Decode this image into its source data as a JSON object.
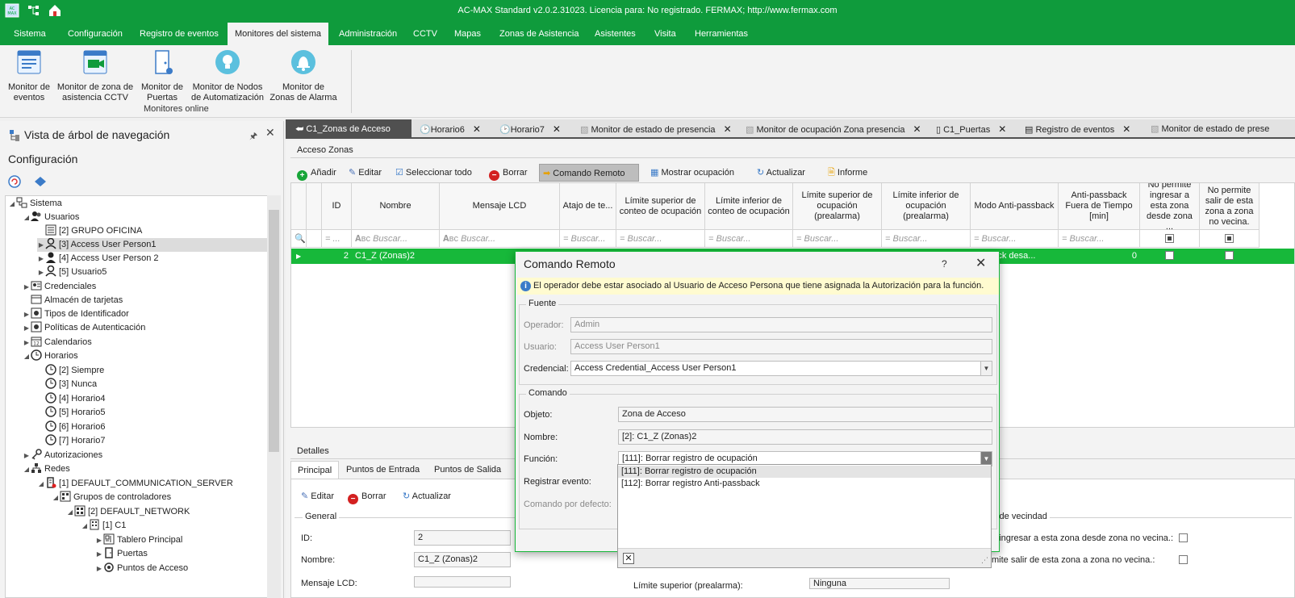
{
  "app": {
    "title": "AC-MAX Standard v2.0.2.31023. Licencia para: No registrado. FERMAX; http://www.fermax.com",
    "accent": "#0f9b3c"
  },
  "ribbon_tabs": [
    {
      "label": "Sistema"
    },
    {
      "label": "Configuración"
    },
    {
      "label": "Registro de eventos"
    },
    {
      "label": "Monitores del sistema"
    },
    {
      "label": "Administración"
    },
    {
      "label": "CCTV"
    },
    {
      "label": "Mapas"
    },
    {
      "label": "Zonas de Asistencia"
    },
    {
      "label": "Asistentes"
    },
    {
      "label": "Visita"
    },
    {
      "label": "Herramientas"
    }
  ],
  "ribbon": {
    "buttons": [
      {
        "label1": "Monitor de",
        "label2": "eventos"
      },
      {
        "label1": "Monitor de zona de",
        "label2": "asistencia CCTV"
      },
      {
        "label1": "Monitor de",
        "label2": "Puertas"
      },
      {
        "label1": "Monitor de Nodos",
        "label2": "de Automatización"
      },
      {
        "label1": "Monitor de",
        "label2": "Zonas de Alarma"
      }
    ],
    "group_label": "Monitores online"
  },
  "nav": {
    "title": "Vista de árbol de navegación",
    "subtitle": "Configuración",
    "tree": [
      {
        "label": "Sistema"
      },
      {
        "label": "Usuarios"
      },
      {
        "label": "[2] GRUPO OFICINA"
      },
      {
        "label": "[3] Access User Person1"
      },
      {
        "label": "[4] Access User Person 2"
      },
      {
        "label": "[5] Usuario5"
      },
      {
        "label": "Credenciales"
      },
      {
        "label": "Almacén de tarjetas"
      },
      {
        "label": "Tipos de Identificador"
      },
      {
        "label": "Políticas de Autenticación"
      },
      {
        "label": "Calendarios"
      },
      {
        "label": "Horarios"
      },
      {
        "label": "[2] Siempre"
      },
      {
        "label": "[3] Nunca"
      },
      {
        "label": "[4] Horario4"
      },
      {
        "label": "[5] Horario5"
      },
      {
        "label": "[6] Horario6"
      },
      {
        "label": "[7] Horario7"
      },
      {
        "label": "Autorizaciones"
      },
      {
        "label": "Redes"
      },
      {
        "label": "[1] DEFAULT_COMMUNICATION_SERVER"
      },
      {
        "label": "Grupos de controladores"
      },
      {
        "label": "[2] DEFAULT_NETWORK"
      },
      {
        "label": "[1] C1"
      },
      {
        "label": "Tablero Principal"
      },
      {
        "label": "Puertas"
      },
      {
        "label": "Puntos de Acceso"
      }
    ]
  },
  "doc_tabs": [
    {
      "label": "C1_Zonas de Acceso"
    },
    {
      "label": "Horario6"
    },
    {
      "label": "Horario7"
    },
    {
      "label": "Monitor de estado de presencia"
    },
    {
      "label": "Monitor de ocupación Zona presencia"
    },
    {
      "label": "C1_Puertas"
    },
    {
      "label": "Registro de eventos"
    },
    {
      "label": "Monitor de estado de prese"
    }
  ],
  "main": {
    "section": "Acceso Zonas",
    "toolbar": {
      "add": "Añadir",
      "edit": "Editar",
      "select_all": "Seleccionar todo",
      "delete": "Borrar",
      "remote": "Comando Remoto",
      "show_occ": "Mostrar ocupación",
      "refresh": "Actualizar",
      "report": "Informe"
    },
    "columns": [
      {
        "label": "ID"
      },
      {
        "label": "Nombre"
      },
      {
        "label": "Mensaje LCD"
      },
      {
        "label": "Atajo de te..."
      },
      {
        "label": "Límite superior de conteo de ocupación"
      },
      {
        "label": "Límite inferior de conteo de ocupación"
      },
      {
        "label": "Límite superior de ocupación (prealarma)"
      },
      {
        "label": "Límite inferior de ocupación (prealarma)"
      },
      {
        "label": "Modo Anti-passback"
      },
      {
        "label": "Anti-passback Fuera de Tiempo [min]"
      },
      {
        "label": "No permite ingresar a esta zona desde zona ..."
      },
      {
        "label": "No permite salir de esta zona a zona no vecina."
      }
    ],
    "filter_placeholder": "Buscar...",
    "row": {
      "id": "2",
      "name": "C1_Z (Zonas)2",
      "antipassback_mode": "assback desa...",
      "antipassback_timeout": "0"
    }
  },
  "details": {
    "title": "Detalles",
    "tabs": [
      {
        "label": "Principal"
      },
      {
        "label": "Puntos de Entrada"
      },
      {
        "label": "Puntos de Salida"
      }
    ],
    "toolbar": {
      "edit": "Editar",
      "delete": "Borrar",
      "refresh": "Actualizar"
    },
    "general_title": "General",
    "id_label": "ID:",
    "id_value": "2",
    "name_label": "Nombre:",
    "name_value": "C1_Z (Zonas)2",
    "lcd_label": "Mensaje LCD:",
    "upper_label": "Límite superior (prealarma):",
    "upper_value": "Ninguna",
    "vecindad_title": "s de vecindad",
    "vec1": "a ingresar a esta zona desde zona no vecina.:",
    "vec2": "mite salir de esta zona a zona no vecina.:"
  },
  "dialog": {
    "title": "Comando Remoto",
    "help": "?",
    "info": "El operador debe estar asociado al Usuario de Acceso Persona que tiene asignada la Autorización para la función.",
    "source_title": "Fuente",
    "operator_label": "Operador:",
    "operator_value": "Admin",
    "user_label": "Usuario:",
    "user_value": "Access User Person1",
    "credential_label": "Credencial:",
    "credential_value": "Access Credential_Access User Person1",
    "command_title": "Comando",
    "object_label": "Objeto:",
    "object_value": "Zona de Acceso",
    "name_label": "Nombre:",
    "name_value": "[2]: C1_Z (Zonas)2",
    "function_label": "Función:",
    "function_value": "[111]: Borrar registro de ocupación",
    "register_label": "Registrar evento:",
    "default_label": "Comando por defecto:",
    "options": [
      {
        "label": "[111]: Borrar registro de ocupación"
      },
      {
        "label": "[112]: Borrar registro Anti-passback"
      }
    ]
  }
}
